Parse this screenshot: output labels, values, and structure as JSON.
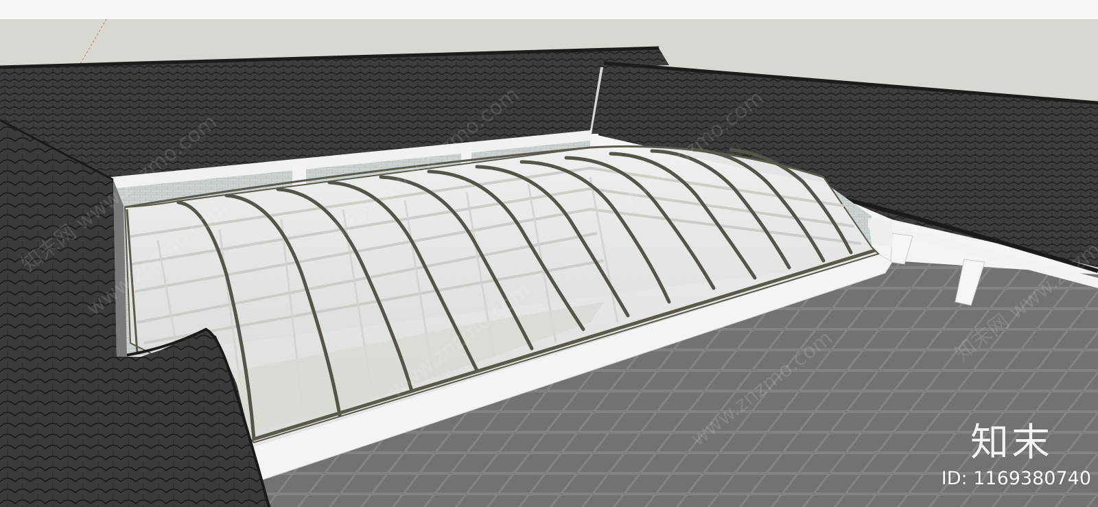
{
  "watermark": {
    "logo_text": "知末",
    "id_text": "ID: 1169380740",
    "site_text": "www.znzmo.com",
    "site_text_cn": "知末网 www.znzmo.com"
  },
  "colors": {
    "sky": "#d7d7d3",
    "header_bar": "#f6f6f6",
    "roof_tile_dark": "#3c3c3c",
    "roof_tile_line": "#252525",
    "floor_tile": "#6b6b6b",
    "floor_grout": "#8e8e8e",
    "glass": "#e6e8e6",
    "glass_frame": "#5b5a4e",
    "wall_white": "#efefef",
    "brick_wall": "#cfd3d3"
  }
}
